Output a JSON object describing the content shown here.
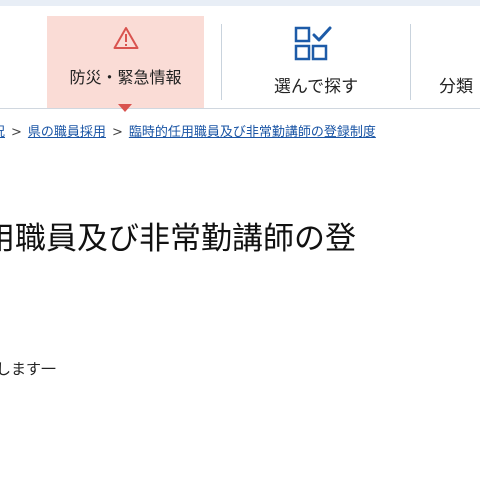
{
  "header": {
    "nav": [
      {
        "label": "防災・緊急情報",
        "icon": "warning-triangle-icon"
      },
      {
        "label": "選んで探す",
        "icon": "checklist-grid-icon"
      },
      {
        "label": "分類"
      }
    ]
  },
  "breadcrumb": {
    "items": [
      "況",
      "県の職員採用",
      "臨時的任用職員及び非常勤講師の登録制度"
    ],
    "separator": ">"
  },
  "page": {
    "title": "用職員及び非常勤講師の登",
    "body": "します一"
  },
  "colors": {
    "alert_background": "#fadcd6",
    "alert_accent": "#d9534f",
    "link": "#1a55a5",
    "icon_blue": "#1d5ba8"
  }
}
